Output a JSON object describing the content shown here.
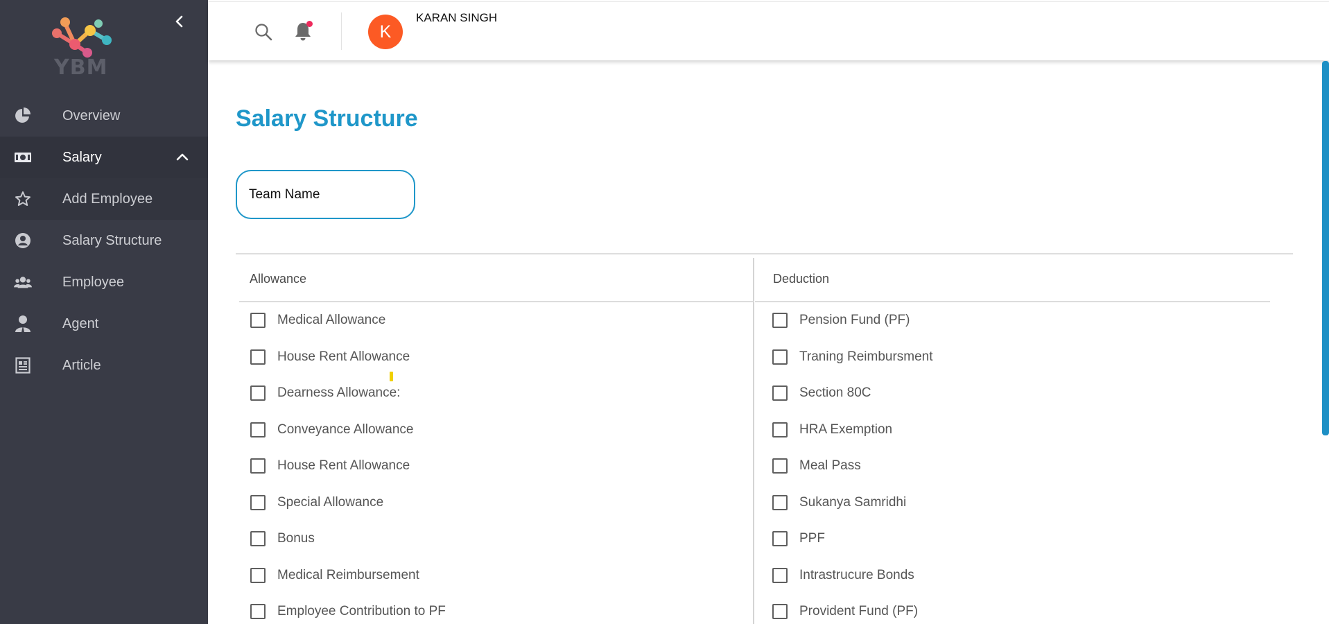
{
  "brand": {
    "logo_text": "YBM",
    "colors": {
      "sidebar_bg": "#393b46",
      "accent": "#1f97c9",
      "avatar": "#fc5a24",
      "notification_dot": "#ee2a5c"
    }
  },
  "sidebar": {
    "items": [
      {
        "label": "Overview",
        "icon": "pie-chart-icon"
      },
      {
        "label": "Salary",
        "icon": "money-icon",
        "expanded": true
      },
      {
        "label": "Add Employee",
        "icon": "star-icon"
      },
      {
        "label": "Salary Structure",
        "icon": "user-circle-icon"
      },
      {
        "label": "Employee",
        "icon": "users-icon"
      },
      {
        "label": "Agent",
        "icon": "agent-icon"
      },
      {
        "label": "Article",
        "icon": "article-icon"
      }
    ]
  },
  "header": {
    "avatar_letter": "K",
    "user_name": "KARAN SINGH"
  },
  "main": {
    "title": "Salary Structure",
    "team_name": {
      "placeholder": "Team Name",
      "value": ""
    },
    "allowance": {
      "header": "Allowance",
      "items": [
        "Medical Allowance",
        "House Rent Allowance",
        "Dearness Allowance:",
        "Conveyance Allowance",
        "House Rent Allowance",
        "Special Allowance",
        "Bonus",
        "Medical Reimbursement",
        "Employee Contribution to PF"
      ]
    },
    "deduction": {
      "header": "Deduction",
      "items": [
        "Pension Fund (PF)",
        "Traning Reimbursment",
        "Section 80C",
        "HRA Exemption",
        "Meal Pass",
        "Sukanya Samridhi",
        "PPF",
        "Intrastrucure Bonds",
        "Provident Fund (PF)"
      ]
    }
  }
}
